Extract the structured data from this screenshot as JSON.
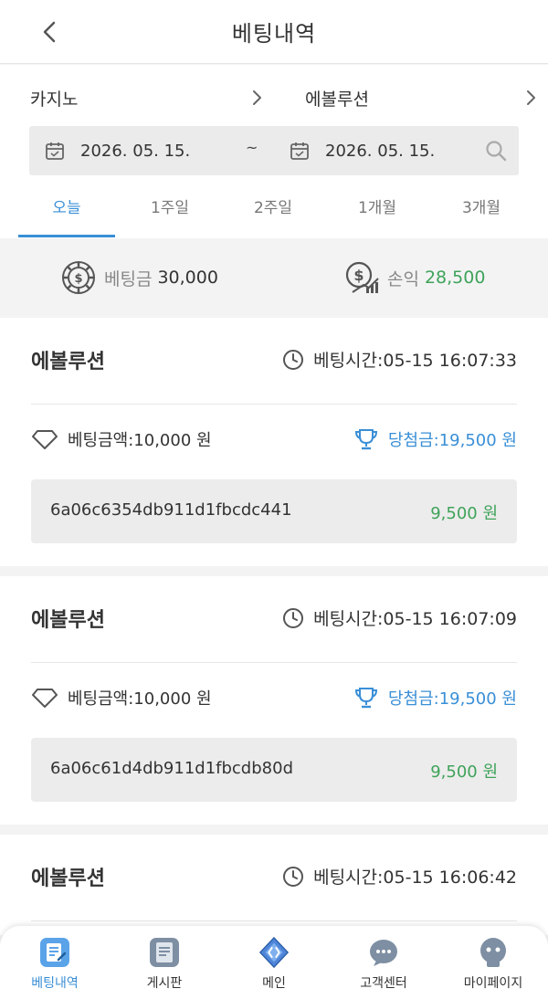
{
  "header": {
    "title": "베팅내역",
    "back_icon": "chevron-left-icon"
  },
  "filters": {
    "category": "카지노",
    "game": "에볼루션",
    "date_from": "2026. 05. 15.",
    "date_separator": "~",
    "date_to": "2026. 05. 15.",
    "tabs": [
      {
        "label": "오늘",
        "active": true
      },
      {
        "label": "1주일",
        "active": false
      },
      {
        "label": "2주일",
        "active": false
      },
      {
        "label": "1개월",
        "active": false
      },
      {
        "label": "3개월",
        "active": false
      }
    ]
  },
  "summary": {
    "bet_label": "베팅금",
    "bet_value": "30,000",
    "profit_label": "손익",
    "profit_value": "28,500"
  },
  "bets": [
    {
      "game": "에볼루션",
      "time": "베팅시간:05-15 16:07:33",
      "amount": "베팅금액:10,000 원",
      "win": "당첨금:19,500 원",
      "hash": "6a06c6354db911d1fbcdc441",
      "profit": "9,500 원"
    },
    {
      "game": "에볼루션",
      "time": "베팅시간:05-15 16:07:09",
      "amount": "베팅금액:10,000 원",
      "win": "당첨금:19,500 원",
      "hash": "6a06c61d4db911d1fbcdb80d",
      "profit": "9,500 원"
    },
    {
      "game": "에볼루션",
      "time": "베팅시간:05-15 16:06:42"
    }
  ],
  "bottom_nav": [
    {
      "label": "베팅내역",
      "icon": "betting-history-icon",
      "active": true
    },
    {
      "label": "게시판",
      "icon": "board-icon",
      "active": false
    },
    {
      "label": "메인",
      "icon": "main-icon",
      "active": false
    },
    {
      "label": "고객센터",
      "icon": "customer-center-icon",
      "active": false
    },
    {
      "label": "마이페이지",
      "icon": "mypage-icon",
      "active": false
    }
  ],
  "colors": {
    "accent": "#3a8fd6",
    "positive": "#3fa35a"
  }
}
